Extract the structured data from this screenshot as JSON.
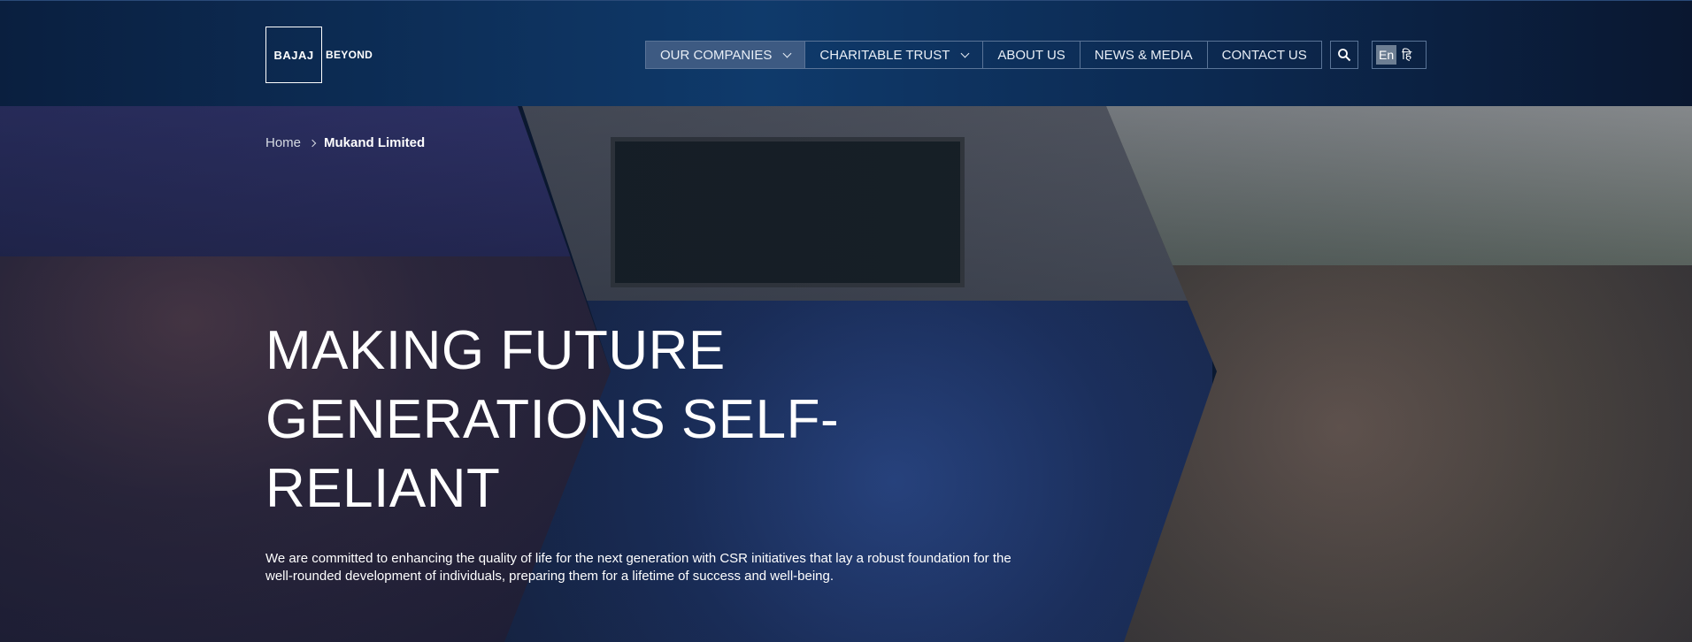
{
  "brand": {
    "logo_text": "BAJAJ",
    "logo_suffix": "BEYOND"
  },
  "nav": {
    "items": [
      {
        "label": "OUR COMPANIES",
        "has_dropdown": true,
        "active": true
      },
      {
        "label": "CHARITABLE TRUST",
        "has_dropdown": true,
        "active": false
      },
      {
        "label": "ABOUT US",
        "has_dropdown": false,
        "active": false
      },
      {
        "label": "NEWS & MEDIA",
        "has_dropdown": false,
        "active": false
      },
      {
        "label": "CONTACT US",
        "has_dropdown": false,
        "active": false
      }
    ]
  },
  "utilities": {
    "search_icon": "search-icon",
    "lang_en": "En",
    "lang_hi": "हि"
  },
  "breadcrumb": {
    "home": "Home",
    "current": "Mukand Limited"
  },
  "hero": {
    "headline": "MAKING FUTURE GENERATIONS SELF-RELIANT",
    "subtext": "We are committed to enhancing the quality of life for the next generation with CSR initiatives that lay a robust foundation for the well-rounded development of individuals, preparing them for a lifetime of success and well-being."
  },
  "colors": {
    "header_bg": "#0f3a6b",
    "nav_active": "#3d5a82",
    "nav_border": "#5a7497"
  }
}
